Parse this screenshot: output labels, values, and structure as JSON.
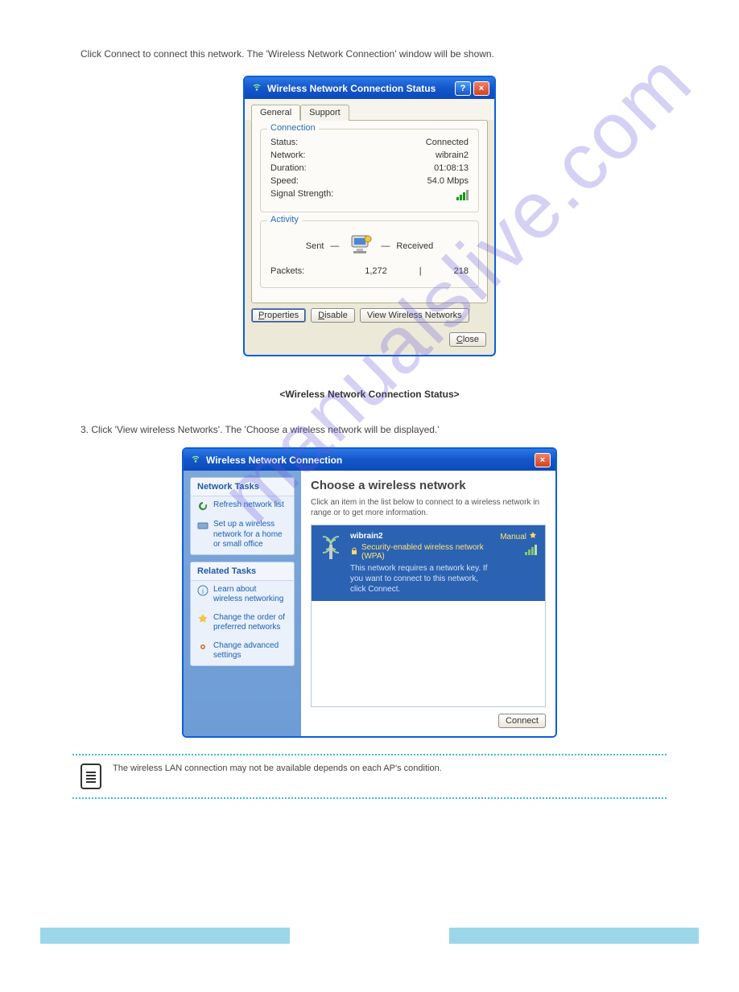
{
  "intro": "Click Connect to connect this network. The 'Wireless Network Connection' window will be shown.",
  "status_dialog": {
    "title": "Wireless Network Connection Status",
    "tabs": {
      "general": "General",
      "support": "Support"
    },
    "connection": {
      "legend": "Connection",
      "status_label": "Status:",
      "status_value": "Connected",
      "network_label": "Network:",
      "network_value": "wibrain2",
      "duration_label": "Duration:",
      "duration_value": "01:08:13",
      "speed_label": "Speed:",
      "speed_value": "54.0 Mbps",
      "signal_label": "Signal Strength:"
    },
    "activity": {
      "legend": "Activity",
      "sent": "Sent",
      "received": "Received",
      "packets_label": "Packets:",
      "packets_sent": "1,272",
      "packets_received": "218"
    },
    "buttons": {
      "properties": "Properties",
      "disable": "Disable",
      "view_wireless": "View Wireless Networks",
      "close": "Close"
    }
  },
  "caption": "<Wireless Network Connection Status>",
  "step": "3. Click 'View wireless Networks'. The 'Choose a wireless network will be displayed.'",
  "wifi_dialog": {
    "title": "Wireless Network Connection",
    "left": {
      "network_tasks": "Network Tasks",
      "refresh": "Refresh network list",
      "setup": "Set up a wireless network for a home or small office",
      "related_tasks": "Related Tasks",
      "learn": "Learn about wireless networking",
      "change_order": "Change the order of preferred networks",
      "change_adv": "Change advanced settings"
    },
    "right": {
      "heading": "Choose a wireless network",
      "desc": "Click an item in the list below to connect to a wireless network in range or to get more information.",
      "net_name": "wibrain2",
      "manual": "Manual",
      "security": "Security-enabled wireless network (WPA)",
      "msg": "This network requires a network key. If you want to connect to this network, click Connect.",
      "connect": "Connect"
    }
  },
  "note": "The wireless LAN connection may not be available depends on each AP's condition.",
  "footer": {
    "left": "",
    "right": ""
  },
  "accel": {
    "P": "P",
    "D": "D",
    "W": "W",
    "C": "C"
  }
}
